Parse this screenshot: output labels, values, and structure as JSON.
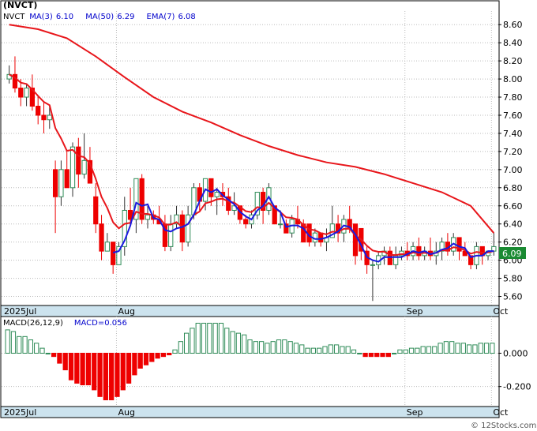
{
  "chart_data": [
    {
      "type": "candlestick",
      "title": "(NVCT)",
      "symbol": "NVCT",
      "legend": [
        {
          "label": "NVCT",
          "value": "",
          "color": "#000000"
        },
        {
          "label": "MA(3)",
          "value": "6.10",
          "color": "#0000cc"
        },
        {
          "label": "MA(50)",
          "value": "6.29",
          "color": "#0000cc"
        },
        {
          "label": "EMA(7)",
          "value": "6.08",
          "color": "#0000cc"
        }
      ],
      "y_ticks": [
        "8.60",
        "8.40",
        "8.20",
        "8.00",
        "7.80",
        "7.60",
        "7.40",
        "7.20",
        "7.00",
        "6.80",
        "6.60",
        "6.40",
        "6.20",
        "6.00",
        "5.80",
        "5.60"
      ],
      "ylim": [
        5.5,
        8.75
      ],
      "x_labels": [
        "2025Jul",
        "Aug",
        "Sep",
        "Oct"
      ],
      "last_price": "6.09",
      "up_color": "#2e8b57",
      "down_color": "#ee0000",
      "candles": [
        [
          8.0,
          8.15,
          7.95,
          8.05
        ],
        [
          8.05,
          8.25,
          7.85,
          7.9
        ],
        [
          7.9,
          8.0,
          7.7,
          7.8
        ],
        [
          7.8,
          7.95,
          7.7,
          7.9
        ],
        [
          7.9,
          8.05,
          7.65,
          7.7
        ],
        [
          7.7,
          7.8,
          7.5,
          7.6
        ],
        [
          7.6,
          7.75,
          7.4,
          7.55
        ],
        [
          7.55,
          7.7,
          7.45,
          7.6
        ],
        [
          7.0,
          7.1,
          6.3,
          6.7
        ],
        [
          6.7,
          7.1,
          6.6,
          7.0
        ],
        [
          7.0,
          7.2,
          6.8,
          6.8
        ],
        [
          6.8,
          7.3,
          6.7,
          7.25
        ],
        [
          7.25,
          7.35,
          6.8,
          6.95
        ],
        [
          6.95,
          7.4,
          6.9,
          7.1
        ],
        [
          7.1,
          7.25,
          6.9,
          6.85
        ],
        [
          6.7,
          6.85,
          6.3,
          6.4
        ],
        [
          6.4,
          6.5,
          6.0,
          6.1
        ],
        [
          6.1,
          6.3,
          6.1,
          6.2
        ],
        [
          6.2,
          6.1,
          5.85,
          5.95
        ],
        [
          5.95,
          6.2,
          5.95,
          6.15
        ],
        [
          6.15,
          6.7,
          6.05,
          6.55
        ],
        [
          6.55,
          6.8,
          6.4,
          6.45
        ],
        [
          6.45,
          6.9,
          6.3,
          6.9
        ],
        [
          6.9,
          6.95,
          6.4,
          6.45
        ],
        [
          6.45,
          6.6,
          6.35,
          6.5
        ],
        [
          6.5,
          6.55,
          6.4,
          6.45
        ],
        [
          6.45,
          6.6,
          6.4,
          6.4
        ],
        [
          6.4,
          6.5,
          6.1,
          6.15
        ],
        [
          6.15,
          6.5,
          6.1,
          6.4
        ],
        [
          6.4,
          6.6,
          6.35,
          6.5
        ],
        [
          6.5,
          6.55,
          6.1,
          6.2
        ],
        [
          6.2,
          6.6,
          6.15,
          6.5
        ],
        [
          6.5,
          6.85,
          6.45,
          6.8
        ],
        [
          6.8,
          6.85,
          6.55,
          6.65
        ],
        [
          6.65,
          6.9,
          6.55,
          6.9
        ],
        [
          6.9,
          6.85,
          6.6,
          6.7
        ],
        [
          6.7,
          6.8,
          6.5,
          6.75
        ],
        [
          6.75,
          6.85,
          6.6,
          6.7
        ],
        [
          6.7,
          6.8,
          6.5,
          6.55
        ],
        [
          6.55,
          6.75,
          6.5,
          6.6
        ],
        [
          6.6,
          6.6,
          6.4,
          6.45
        ],
        [
          6.45,
          6.5,
          6.35,
          6.4
        ],
        [
          6.4,
          6.55,
          6.35,
          6.5
        ],
        [
          6.5,
          6.75,
          6.45,
          6.75
        ],
        [
          6.75,
          6.8,
          6.4,
          6.55
        ],
        [
          6.55,
          6.85,
          6.5,
          6.8
        ],
        [
          6.6,
          6.6,
          6.4,
          6.4
        ],
        [
          6.4,
          6.55,
          6.35,
          6.4
        ],
        [
          6.4,
          6.45,
          6.3,
          6.3
        ],
        [
          6.3,
          6.5,
          6.25,
          6.45
        ],
        [
          6.45,
          6.6,
          6.35,
          6.4
        ],
        [
          6.4,
          6.45,
          6.2,
          6.2
        ],
        [
          6.4,
          6.4,
          6.15,
          6.2
        ],
        [
          6.2,
          6.35,
          6.15,
          6.3
        ],
        [
          6.3,
          6.3,
          6.15,
          6.2
        ],
        [
          6.2,
          6.35,
          6.1,
          6.25
        ],
        [
          6.25,
          6.6,
          6.25,
          6.4
        ],
        [
          6.4,
          6.5,
          6.2,
          6.3
        ],
        [
          6.3,
          6.5,
          6.2,
          6.45
        ],
        [
          6.45,
          6.6,
          6.3,
          6.35
        ],
        [
          6.4,
          6.4,
          5.95,
          6.05
        ],
        [
          6.35,
          6.35,
          6.0,
          6.1
        ],
        [
          6.1,
          6.15,
          5.85,
          5.95
        ],
        [
          5.95,
          6.0,
          5.55,
          5.95
        ],
        [
          5.95,
          6.1,
          5.9,
          6.05
        ],
        [
          6.05,
          6.15,
          5.95,
          6.1
        ],
        [
          6.1,
          6.15,
          5.95,
          5.95
        ],
        [
          5.95,
          6.15,
          5.9,
          6.05
        ],
        [
          6.05,
          6.15,
          6.0,
          6.1
        ],
        [
          6.1,
          6.2,
          6.0,
          6.05
        ],
        [
          6.05,
          6.2,
          6.0,
          6.15
        ],
        [
          6.15,
          6.25,
          6.0,
          6.05
        ],
        [
          6.05,
          6.15,
          6.0,
          6.1
        ],
        [
          6.1,
          6.25,
          6.0,
          6.05
        ],
        [
          6.05,
          6.2,
          5.95,
          6.1
        ],
        [
          6.1,
          6.25,
          6.0,
          6.2
        ],
        [
          6.2,
          6.3,
          6.05,
          6.1
        ],
        [
          6.1,
          6.3,
          6.05,
          6.25
        ],
        [
          6.25,
          6.2,
          6.0,
          6.1
        ],
        [
          6.1,
          6.2,
          6.05,
          6.05
        ],
        [
          6.05,
          6.05,
          5.9,
          5.95
        ],
        [
          5.95,
          6.2,
          5.9,
          6.15
        ],
        [
          6.15,
          6.1,
          5.95,
          6.05
        ],
        [
          6.05,
          6.1,
          6.0,
          6.1
        ],
        [
          6.1,
          6.3,
          6.05,
          6.15
        ]
      ],
      "ma50": [
        [
          0,
          8.6
        ],
        [
          5,
          8.55
        ],
        [
          10,
          8.45
        ],
        [
          15,
          8.25
        ],
        [
          20,
          8.02
        ],
        [
          25,
          7.8
        ],
        [
          30,
          7.64
        ],
        [
          35,
          7.52
        ],
        [
          40,
          7.38
        ],
        [
          45,
          7.26
        ],
        [
          50,
          7.16
        ],
        [
          55,
          7.08
        ],
        [
          60,
          7.03
        ],
        [
          65,
          6.95
        ],
        [
          70,
          6.85
        ],
        [
          75,
          6.75
        ],
        [
          80,
          6.6
        ],
        [
          84,
          6.3
        ]
      ]
    },
    {
      "type": "bar",
      "title": "MACD(26,12,9)",
      "legend": [
        {
          "label": "MACD(26,12,9)",
          "value": "",
          "color": "#000000"
        },
        {
          "label": "MACD",
          "value": "0.056",
          "color": "#0000cc"
        }
      ],
      "y_ticks": [
        "0.000",
        "-0.200"
      ],
      "ylim": [
        -0.32,
        0.22
      ],
      "x_labels": [
        "2025Jul",
        "Aug",
        "Sep",
        "Oct"
      ],
      "pos_color": "#2e8b57",
      "neg_color": "#ee0000",
      "values": [
        0.14,
        0.13,
        0.1,
        0.1,
        0.08,
        0.06,
        0.03,
        0.0,
        -0.02,
        -0.06,
        -0.1,
        -0.16,
        -0.18,
        -0.19,
        -0.19,
        -0.22,
        -0.26,
        -0.28,
        -0.28,
        -0.26,
        -0.22,
        -0.18,
        -0.13,
        -0.09,
        -0.07,
        -0.05,
        -0.03,
        -0.02,
        -0.01,
        0.02,
        0.07,
        0.12,
        0.15,
        0.18,
        0.18,
        0.18,
        0.18,
        0.18,
        0.15,
        0.13,
        0.12,
        0.11,
        0.08,
        0.07,
        0.07,
        0.06,
        0.07,
        0.08,
        0.08,
        0.07,
        0.06,
        0.05,
        0.03,
        0.03,
        0.03,
        0.04,
        0.05,
        0.05,
        0.04,
        0.04,
        0.02,
        0.0,
        -0.02,
        -0.02,
        -0.02,
        -0.02,
        -0.02,
        0.0,
        0.02,
        0.02,
        0.03,
        0.03,
        0.04,
        0.04,
        0.04,
        0.06,
        0.07,
        0.07,
        0.06,
        0.06,
        0.05,
        0.05,
        0.06,
        0.06,
        0.06
      ]
    }
  ],
  "footer": {
    "credit": "© 12Stocks.com"
  }
}
